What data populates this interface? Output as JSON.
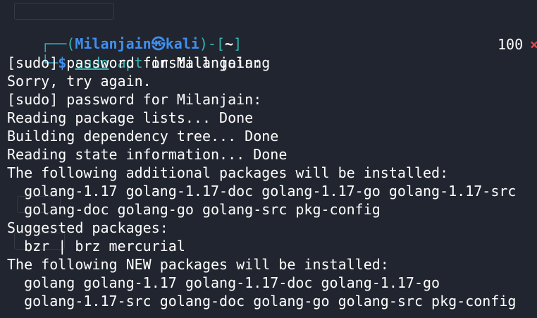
{
  "prompt": {
    "corner_top": "┌──",
    "corner_bottom": "└─",
    "open_paren": "(",
    "user": "Milanjain",
    "symbol": "㉿",
    "host": "kali",
    "close_paren": ")-",
    "dir_open": "[",
    "dir": "~",
    "dir_close": "]",
    "dollar": "$",
    "cmd_sudo": "sudo",
    "cmd_apt": "apt",
    "cmd_rest": " install golang",
    "exit_code": "100",
    "exit_mark": "×"
  },
  "output": [
    "[sudo] password for Milanjain:",
    "Sorry, try again.",
    "[sudo] password for Milanjain:",
    "Reading package lists... Done",
    "Building dependency tree... Done",
    "Reading state information... Done",
    "The following additional packages will be installed:",
    "  golang-1.17 golang-1.17-doc golang-1.17-go golang-1.17-src",
    "  golang-doc golang-go golang-src pkg-config",
    "Suggested packages:",
    "  bzr | brz mercurial",
    "The following NEW packages will be installed:",
    "  golang golang-1.17 golang-1.17-doc golang-1.17-go",
    "  golang-1.17-src golang-doc golang-go golang-src pkg-config"
  ],
  "colors": {
    "background": "#21252f",
    "prompt_blue": "#3f8ff0",
    "command_teal": "#2fb8b0",
    "error_red": "#e8464b",
    "text": "#ffffff"
  }
}
